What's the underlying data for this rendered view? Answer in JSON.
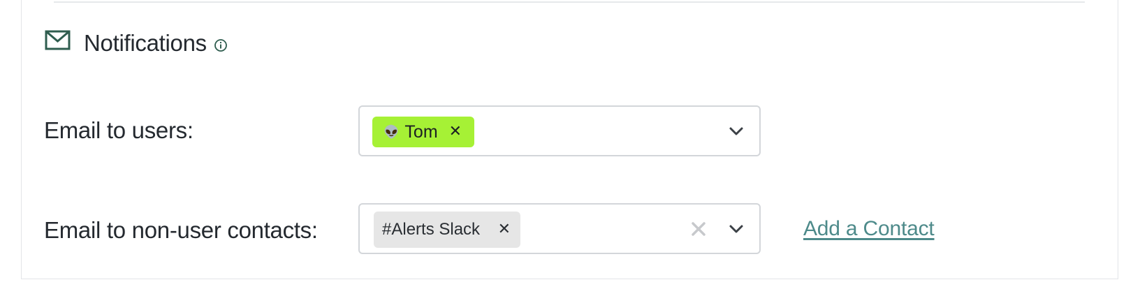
{
  "section": {
    "title": "Notifications",
    "icon": "mail-icon",
    "info_icon": "info-icon"
  },
  "email_users": {
    "label": "Email to users:",
    "selected": [
      {
        "emoji": "👽",
        "name": "Tom",
        "color": "#a6f135"
      }
    ]
  },
  "email_contacts": {
    "label": "Email to non-user contacts:",
    "selected": [
      {
        "name": "#Alerts Slack",
        "color": "#e6e6e6"
      }
    ],
    "add_contact_label": "Add a Contact"
  },
  "colors": {
    "accent": "#2f5d4f",
    "link": "#4d8a8a",
    "chip_user": "#a6f135",
    "chip_contact": "#e6e6e6"
  }
}
